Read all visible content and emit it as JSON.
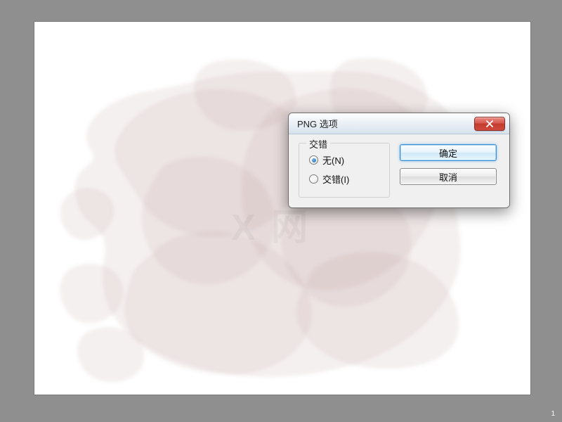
{
  "page_number": "1",
  "watermark": "X 网",
  "dialog": {
    "title": "PNG 选项",
    "group_label": "交错",
    "options": {
      "none": {
        "label": "无(N)",
        "selected": true
      },
      "interlaced": {
        "label": "交错(I)",
        "selected": false
      }
    },
    "buttons": {
      "ok": "确定",
      "cancel": "取消"
    }
  }
}
